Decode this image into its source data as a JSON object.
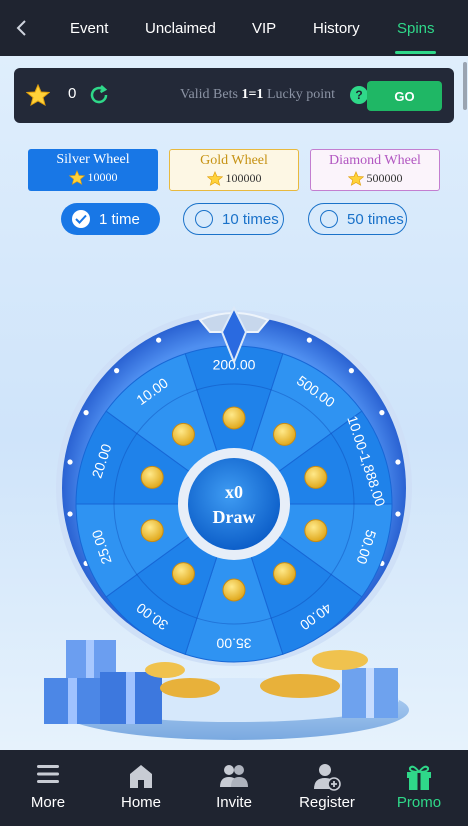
{
  "nav": {
    "back_icon": "chevron-left-icon",
    "tabs": [
      {
        "label": "Event",
        "active": false
      },
      {
        "label": "Unclaimed",
        "active": false
      },
      {
        "label": "VIP",
        "active": false
      },
      {
        "label": "History",
        "active": false
      },
      {
        "label": "Spins",
        "active": true
      }
    ]
  },
  "bets": {
    "count": "0",
    "valid_prefix": "Valid Bets ",
    "ratio": "1=1",
    "valid_suffix": " Lucky point",
    "help": "?",
    "go_label": "GO"
  },
  "wheel_types": [
    {
      "name": "Silver Wheel",
      "cost": "10000",
      "selected": true
    },
    {
      "name": "Gold Wheel",
      "cost": "100000",
      "selected": false
    },
    {
      "name": "Diamond Wheel",
      "cost": "500000",
      "selected": false
    }
  ],
  "times": [
    {
      "label": "1 time",
      "selected": true
    },
    {
      "label": "10 times",
      "selected": false
    },
    {
      "label": "50 times",
      "selected": false
    }
  ],
  "wheel": {
    "prizes": [
      "200.00",
      "500.00",
      "10.00-1,888.00",
      "50.00",
      "40.00",
      "35.00",
      "30.00",
      "25.00",
      "20.00",
      "10.00"
    ],
    "center_multiplier": "x0",
    "center_label": "Draw"
  },
  "bottom_nav": [
    {
      "label": "More",
      "icon": "menu-icon",
      "active": false
    },
    {
      "label": "Home",
      "icon": "home-icon",
      "active": false
    },
    {
      "label": "Invite",
      "icon": "users-icon",
      "active": false
    },
    {
      "label": "Register",
      "icon": "user-plus-icon",
      "active": false
    },
    {
      "label": "Promo",
      "icon": "gift-icon",
      "active": true
    }
  ],
  "colors": {
    "accent_green": "#2fd889",
    "go_green": "#1fb765",
    "blue": "#1877e6",
    "dark": "#1f2430"
  }
}
